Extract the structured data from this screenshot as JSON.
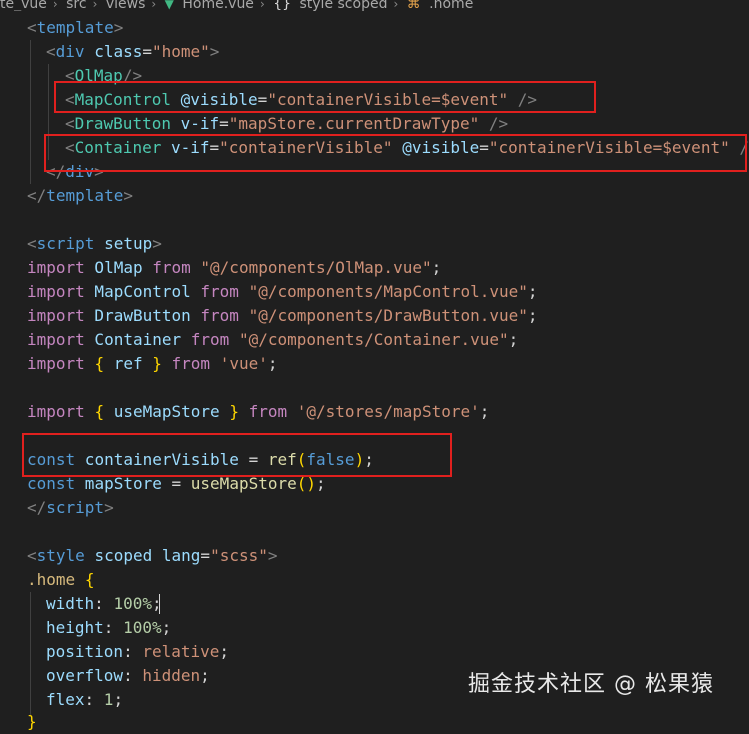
{
  "breadcrumb": {
    "items": [
      "te_vue",
      "src",
      "views",
      "Home.vue",
      "style scoped",
      ".home"
    ],
    "icons": {
      "vue_file": "vue-icon",
      "scope": "curly-braces-icon",
      "selector": "selector-icon"
    }
  },
  "code": {
    "l1": {
      "a": "<",
      "b": "template",
      "c": ">"
    },
    "l2": {
      "a": "<",
      "b": "div",
      "c": " ",
      "d": "class",
      "e": "=",
      "f": "\"home\"",
      "g": ">"
    },
    "l3": {
      "a": "<",
      "b": "OlMap",
      "c": "/>"
    },
    "l4": {
      "a": "<",
      "b": "MapControl",
      "c": " ",
      "d": "@visible",
      "e": "=",
      "f": "\"containerVisible=$event\"",
      "g": " />"
    },
    "l5": {
      "a": "<",
      "b": "DrawButton",
      "c": " ",
      "d": "v-if",
      "e": "=",
      "f": "\"mapStore.currentDrawType\"",
      "g": " />"
    },
    "l6": {
      "a": "<",
      "b": "Container",
      "c": " ",
      "d": "v-if",
      "e": "=",
      "f": "\"containerVisible\"",
      "g": " ",
      "h": "@visible",
      "i": "=",
      "j": "\"containerVisible=$event\"",
      "k": " /"
    },
    "l7": {
      "a": "</",
      "b": "div",
      "c": ">"
    },
    "l8": {
      "a": "</",
      "b": "template",
      "c": ">"
    },
    "l9": {
      "a": "<",
      "b": "script",
      "c": " ",
      "d": "setup",
      "e": ">"
    },
    "l10": {
      "a": "import",
      "b": " OlMap ",
      "c": "from",
      "d": " ",
      "e": "\"@/components/OlMap.vue\"",
      "f": ";"
    },
    "l11": {
      "a": "import",
      "b": " MapControl ",
      "c": "from",
      "d": " ",
      "e": "\"@/components/MapControl.vue\"",
      "f": ";"
    },
    "l12": {
      "a": "import",
      "b": " DrawButton ",
      "c": "from",
      "d": " ",
      "e": "\"@/components/DrawButton.vue\"",
      "f": ";"
    },
    "l13": {
      "a": "import",
      "b": " Container ",
      "c": "from",
      "d": " ",
      "e": "\"@/components/Container.vue\"",
      "f": ";"
    },
    "l14": {
      "a": "import",
      "b": " ",
      "c": "{",
      "d": " ref ",
      "e": "}",
      "f": " ",
      "g": "from",
      "h": " ",
      "i": "'vue'",
      "j": ";"
    },
    "l15": {
      "a": "import",
      "b": " ",
      "c": "{",
      "d": " useMapStore ",
      "e": "}",
      "f": " ",
      "g": "from",
      "h": " ",
      "i": "'@/stores/mapStore'",
      "j": ";"
    },
    "l16": {
      "a": "const",
      "b": " containerVisible ",
      "c": "=",
      "d": " ",
      "e": "ref",
      "f": "(",
      "g": "false",
      "h": ")",
      "i": ";"
    },
    "l17": {
      "a": "const",
      "b": " mapStore ",
      "c": "=",
      "d": " ",
      "e": "useMapStore",
      "f": "(",
      "g": ")",
      "h": ";"
    },
    "l18": {
      "a": "</",
      "b": "script",
      "c": ">"
    },
    "l19": {
      "a": "<",
      "b": "style",
      "c": " ",
      "d": "scoped",
      "e": " ",
      "f": "lang",
      "g": "=",
      "h": "\"scss\"",
      "i": ">"
    },
    "l20": {
      "a": ".home",
      "b": " ",
      "c": "{"
    },
    "l21": {
      "a": "width",
      "b": ": ",
      "c": "100%",
      "d": ";"
    },
    "l22": {
      "a": "height",
      "b": ": ",
      "c": "100%",
      "d": ";"
    },
    "l23": {
      "a": "position",
      "b": ": ",
      "c": "relative",
      "d": ";"
    },
    "l24": {
      "a": "overflow",
      "b": ": ",
      "c": "hidden",
      "d": ";"
    },
    "l25": {
      "a": "flex",
      "b": ": ",
      "c": "1",
      "d": ";"
    },
    "l26": {
      "a": "}"
    }
  },
  "watermark": "掘金技术社区 @ 松果猿",
  "colors": {
    "background": "#1f1f1f",
    "highlight_box": "#e0201e",
    "tag": "#569cd6",
    "component": "#4ec9b0",
    "attribute": "#9cdcfe",
    "string": "#ce9178",
    "keyword": "#c586c0"
  }
}
